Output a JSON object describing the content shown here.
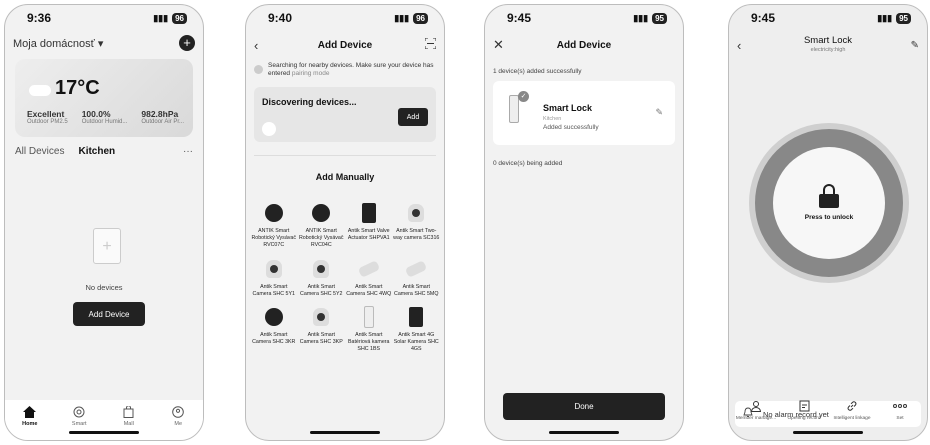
{
  "screen1": {
    "time": "9:36",
    "battery": "96",
    "home_name": "Moja domácnosť",
    "dropdown": "▾",
    "add_symbol": "+",
    "weather": {
      "temperature": "17°C",
      "stats": [
        {
          "value": "Excellent",
          "label": "Outdoor PM2.5"
        },
        {
          "value": "100.0%",
          "label": "Outdoor Humid..."
        },
        {
          "value": "982.8hPa",
          "label": "Outdoor Air Pr..."
        }
      ]
    },
    "tabs": {
      "all": "All Devices",
      "kitchen": "Kitchen",
      "more": "···"
    },
    "empty_plus": "+",
    "empty_text": "No devices",
    "add_button": "Add Device",
    "tabbar": [
      {
        "label": "Home",
        "icon": "home-icon"
      },
      {
        "label": "Smart",
        "icon": "smart-icon"
      },
      {
        "label": "Mall",
        "icon": "mall-bag-icon"
      },
      {
        "label": "Me",
        "icon": "profile-icon"
      }
    ]
  },
  "screen2": {
    "time": "9:40",
    "battery": "96",
    "back": "‹",
    "title": "Add Device",
    "hint_text": "Searching for nearby devices. Make sure your device has entered",
    "hint_link": "pairing mode",
    "discovering": "Discovering devices...",
    "add_button": "Add",
    "manual_title": "Add Manually",
    "devices": [
      {
        "label": "ANTIK Smart Robotický Vysávač RVC07C",
        "kind": "round"
      },
      {
        "label": "ANTIK Smart Robotický Vysávač RVC04C",
        "kind": "round"
      },
      {
        "label": "Antik Smart Valve Actuator SHPVA1",
        "kind": "valve"
      },
      {
        "label": "Antik Smart Two-way camera SC316",
        "kind": "cam"
      },
      {
        "label": "Antik Smart Camera SHC 5Y1",
        "kind": "cam"
      },
      {
        "label": "Antik Smart Camera SHC 5Y2",
        "kind": "cam"
      },
      {
        "label": "Antik Smart Camera SHC 4WQ",
        "kind": "bullet"
      },
      {
        "label": "Antik Smart Camera SHC 5MQ",
        "kind": "bullet"
      },
      {
        "label": "Antik Smart Camera SHC 3KR",
        "kind": "round"
      },
      {
        "label": "Antik Smart Camera SHC 3KP",
        "kind": "cam"
      },
      {
        "label": "Antik Smart Batériová kamera SHC 1BS",
        "kind": "lock"
      },
      {
        "label": "Antik Smart 4G Solar Kamera SHC 4GS",
        "kind": "valve"
      }
    ]
  },
  "screen3": {
    "time": "9:45",
    "battery": "95",
    "close": "✕",
    "title": "Add Device",
    "success_msg": "1 device(s) added successfully",
    "device_name": "Smart Lock",
    "device_room": "Kitchen",
    "device_status": "Added successfully",
    "check": "✓",
    "edit": "✎",
    "adding_msg": "0 device(s) being added",
    "done_button": "Done"
  },
  "screen4": {
    "time": "9:45",
    "battery": "95",
    "back": "‹",
    "title": "Smart Lock",
    "subtitle": "electricity:high",
    "edit": "✎",
    "press_text": "Press to unlock",
    "alarm_text": "No alarm record yet",
    "functions": [
      {
        "label": "Member manage...",
        "icon": "member-icon"
      },
      {
        "label": "Opening record",
        "icon": "record-icon"
      },
      {
        "label": "Intelligent linkage",
        "icon": "link-icon"
      },
      {
        "label": "Set",
        "icon": "more-icon"
      }
    ]
  },
  "colors": {
    "accent": "#222222",
    "card": "#ffffff",
    "background": "#f2f2f2"
  }
}
